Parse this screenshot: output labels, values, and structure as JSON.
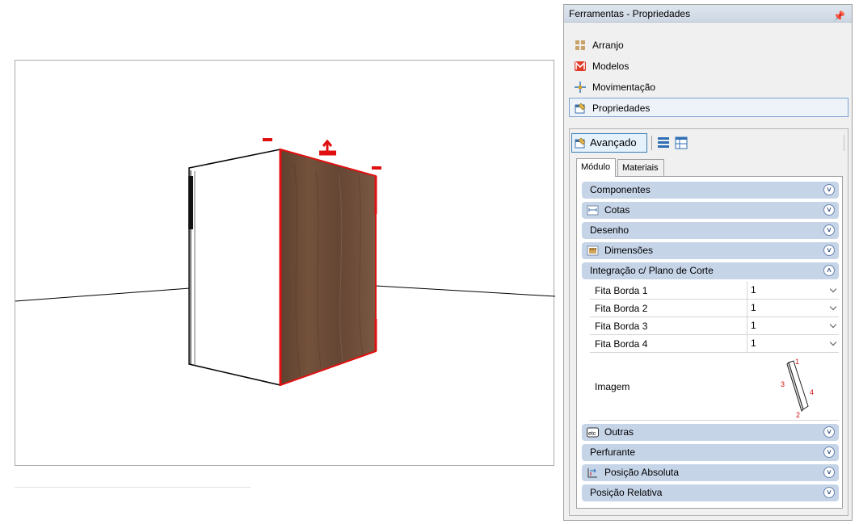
{
  "panel": {
    "title": "Ferramentas - Propriedades",
    "pin_icon": "pin-icon",
    "tools": [
      {
        "label": "Arranjo",
        "icon": "arrange-icon",
        "active": false
      },
      {
        "label": "Modelos",
        "icon": "models-icon",
        "active": false
      },
      {
        "label": "Movimentação",
        "icon": "move-icon",
        "active": false
      },
      {
        "label": "Propriedades",
        "icon": "properties-icon",
        "active": true
      }
    ]
  },
  "toolbar": {
    "advanced_label": "Avançado",
    "list_icon": "list-view-icon",
    "grid_icon": "table-view-icon"
  },
  "tabs": [
    {
      "label": "Módulo",
      "selected": true
    },
    {
      "label": "Materiais",
      "selected": false
    }
  ],
  "groups": [
    {
      "label": "Componentes",
      "icon": null,
      "expanded": false
    },
    {
      "label": "Cotas",
      "icon": "dimensions-icon",
      "expanded": false
    },
    {
      "label": "Desenho",
      "icon": null,
      "expanded": false
    },
    {
      "label": "Dimensões",
      "icon": "ruler-icon",
      "expanded": false
    },
    {
      "label": "Integração c/ Plano de Corte",
      "icon": null,
      "expanded": true
    },
    {
      "label": "Outras",
      "icon": "etc-icon",
      "expanded": false
    },
    {
      "label": "Perfurante",
      "icon": null,
      "expanded": false
    },
    {
      "label": "Posição Absoluta",
      "icon": "absolute-position-icon",
      "expanded": false
    },
    {
      "label": "Posição Relativa",
      "icon": null,
      "expanded": false
    }
  ],
  "integration_props": [
    {
      "label": "Fita Borda 1",
      "value": "1"
    },
    {
      "label": "Fita Borda 2",
      "value": "1"
    },
    {
      "label": "Fita Borda 3",
      "value": "1"
    },
    {
      "label": "Fita Borda 4",
      "value": "1"
    }
  ],
  "image_row": {
    "label": "Imagem",
    "edge_numbers": [
      "1",
      "2",
      "3",
      "4"
    ]
  },
  "colors": {
    "selection_red": "#e01010",
    "wood": "#6b4a35",
    "group_bg": "#c6d4e8",
    "active_border": "#7da2ce"
  }
}
